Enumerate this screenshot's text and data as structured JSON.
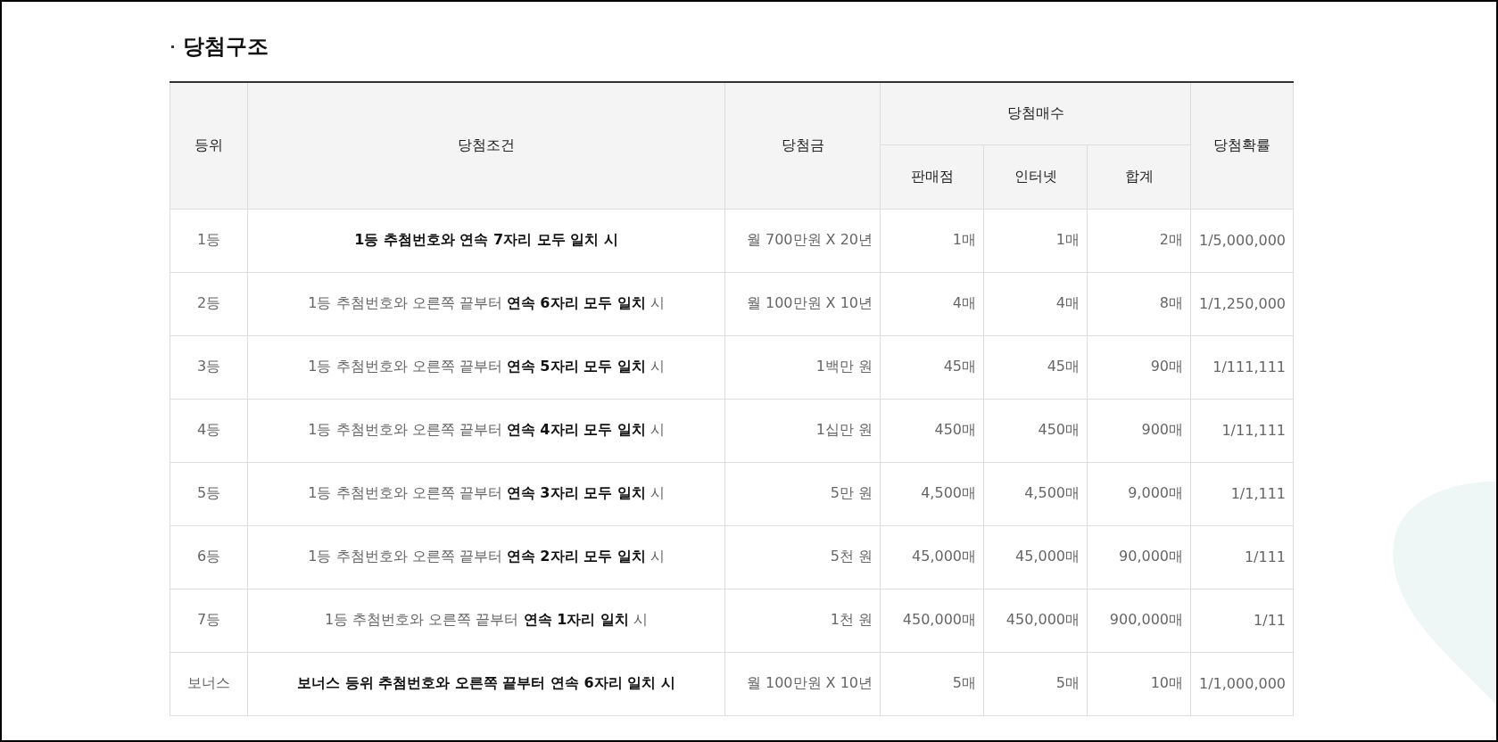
{
  "section_title": "당첨구조",
  "table": {
    "header": {
      "rank": "등위",
      "condition": "당첨조건",
      "prize": "당첨금",
      "count_group": "당첨매수",
      "count_columns": [
        "판매점",
        "인터넷",
        "합계"
      ],
      "odds": "당첨확률"
    },
    "rows": [
      {
        "rank": "1등",
        "condition": "1등 추첨번호와 연속 7자리 모두 일치 시",
        "bold": true,
        "prize": "월 700만원 X 20년",
        "store": "1매",
        "internet": "1매",
        "total": "2매",
        "odds": "1/5,000,000"
      },
      {
        "rank": "2등",
        "condition": "1등 추첨번호와 오른쪽 끝부터 **연속 6자리 모두 일치** 시",
        "bold": false,
        "prize": "월 100만원 X 10년",
        "store": "4매",
        "internet": "4매",
        "total": "8매",
        "odds": "1/1,250,000"
      },
      {
        "rank": "3등",
        "condition": "1등 추첨번호와 오른쪽 끝부터 **연속 5자리 모두 일치** 시",
        "bold": false,
        "prize": "1백만 원",
        "store": "45매",
        "internet": "45매",
        "total": "90매",
        "odds": "1/111,111"
      },
      {
        "rank": "4등",
        "condition": "1등 추첨번호와 오른쪽 끝부터 **연속 4자리 모두 일치** 시",
        "bold": false,
        "prize": "1십만 원",
        "store": "450매",
        "internet": "450매",
        "total": "900매",
        "odds": "1/11,111"
      },
      {
        "rank": "5등",
        "condition": "1등 추첨번호와 오른쪽 끝부터 **연속 3자리 모두 일치** 시",
        "bold": false,
        "prize": "5만 원",
        "store": "4,500매",
        "internet": "4,500매",
        "total": "9,000매",
        "odds": "1/1,111"
      },
      {
        "rank": "6등",
        "condition": "1등 추첨번호와 오른쪽 끝부터 **연속 2자리 모두 일치** 시",
        "bold": false,
        "prize": "5천 원",
        "store": "45,000매",
        "internet": "45,000매",
        "total": "90,000매",
        "odds": "1/111"
      },
      {
        "rank": "7등",
        "condition": "1등 추첨번호와 오른쪽 끝부터 **연속 1자리 일치** 시",
        "bold": false,
        "prize": "1천 원",
        "store": "450,000매",
        "internet": "450,000매",
        "total": "900,000매",
        "odds": "1/11"
      },
      {
        "rank": "보너스",
        "condition": "보너스 등위 추첨번호와 오른쪽 끝부터 연속 6자리 일치 시",
        "bold": true,
        "prize": "월 100만원 X 10년",
        "store": "5매",
        "internet": "5매",
        "total": "10매",
        "odds": "1/1,000,000"
      }
    ]
  }
}
